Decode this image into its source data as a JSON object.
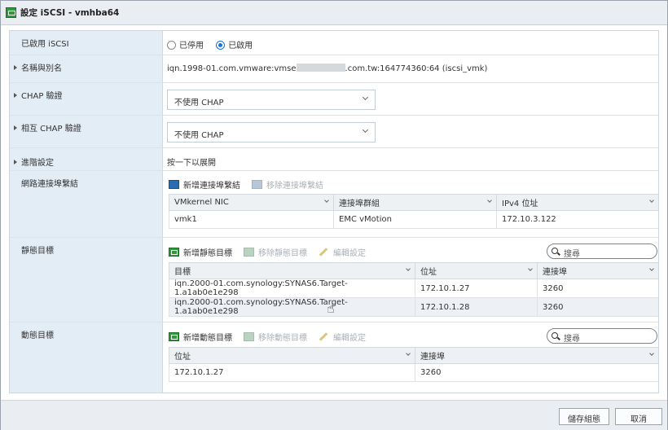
{
  "window": {
    "title": "設定 iSCSI - vmhba64"
  },
  "rows": {
    "enable": {
      "label": "已啟用 iSCSI",
      "disabled_label": "已停用",
      "enabled_label": "已啟用",
      "selected": "enabled"
    },
    "name_alias": {
      "label": "名稱與別名",
      "value_prefix": "iqn.1998-01.com.vmware:vmse",
      "value_suffix": ".com.tw:164774360:64 (iscsi_vmk)"
    },
    "chap": {
      "label": "CHAP 驗證",
      "value": "不使用 CHAP"
    },
    "mutual_chap": {
      "label": "相互 CHAP 驗證",
      "value": "不使用 CHAP"
    },
    "advanced": {
      "label": "進階設定",
      "value": "按一下以展開"
    },
    "port_binding": {
      "label": "網路連接埠繫結",
      "add_label": "新增連接埠繫結",
      "remove_label": "移除連接埠繫結",
      "columns": [
        "VMkernel NIC",
        "連接埠群組",
        "IPv4 位址"
      ],
      "rows": [
        [
          "vmk1",
          "EMC vMotion",
          "172.10.3.122"
        ]
      ]
    },
    "static_targets": {
      "label": "靜態目標",
      "add_label": "新增靜態目標",
      "remove_label": "移除靜態目標",
      "edit_label": "編輯設定",
      "search_placeholder": "搜尋",
      "columns": [
        "目標",
        "位址",
        "連接埠"
      ],
      "rows": [
        [
          "iqn.2000-01.com.synology:SYNAS6.Target-1.a1ab0e1e298",
          "172.10.1.27",
          "3260"
        ],
        [
          "iqn.2000-01.com.synology:SYNAS6.Target-1.a1ab0e1e298",
          "172.10.1.28",
          "3260"
        ]
      ]
    },
    "dynamic_targets": {
      "label": "動態目標",
      "add_label": "新增動態目標",
      "remove_label": "移除動態目標",
      "edit_label": "編輯設定",
      "search_placeholder": "搜尋",
      "columns": [
        "位址",
        "連接埠"
      ],
      "rows": [
        [
          "172.10.1.27",
          "3260"
        ]
      ]
    }
  },
  "footer": {
    "save_label": "儲存組態",
    "cancel_label": "取消"
  },
  "colors": {
    "label_bg": "#e3edf6",
    "accent": "#1a73d9",
    "green_icon": "#2e9a3a"
  }
}
